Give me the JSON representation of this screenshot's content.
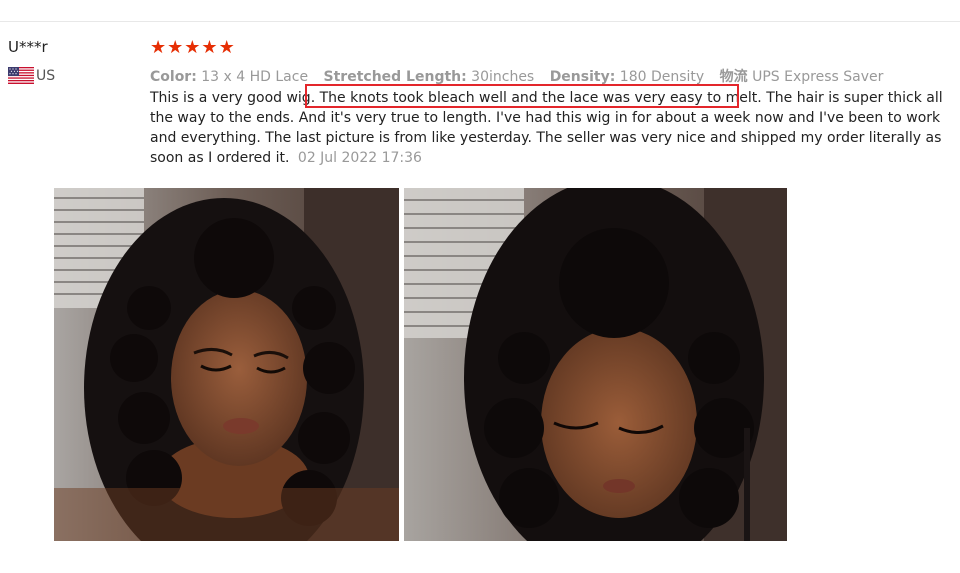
{
  "review": {
    "user": "U***r",
    "country_code": "US",
    "rating": 5,
    "attributes": [
      {
        "label": "Color:",
        "value": "13 x 4 HD Lace"
      },
      {
        "label": "Stretched Length:",
        "value": "30inches"
      },
      {
        "label": "Density:",
        "value": "180 Density"
      }
    ],
    "shipping_label": "物流",
    "shipping_value": "UPS Express Saver",
    "text_before": "This is a very good wig.",
    "text_highlight": "The knots took bleach well and the lace was very easy to melt.",
    "text_after": "The hair is super thick all the way to the ends. And it's very true to length. I've had this wig in for about a week now and I've been to work and everything. The last picture is from like yesterday. The seller was very nice and shipped my order literally as soon as I ordered it.",
    "date": "02 Jul 2022 17:36"
  },
  "colors": {
    "star": "#e62e04",
    "highlight_border": "#e3262b",
    "muted_text": "#999999"
  },
  "photos": [
    {
      "subject": "review-photo-1"
    },
    {
      "subject": "review-photo-2"
    }
  ]
}
